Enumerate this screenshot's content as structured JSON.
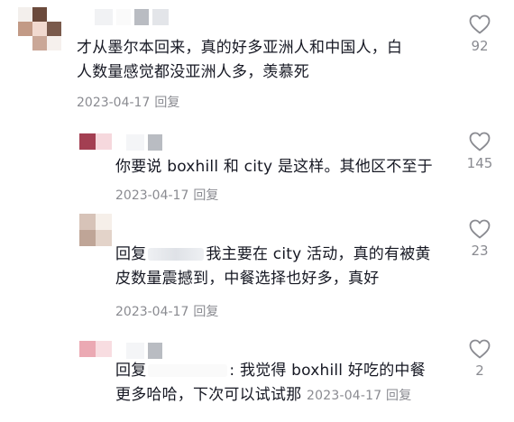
{
  "comments": [
    {
      "text_line1": "才从墨尔本回来，真的好多亚洲人和中国人，白",
      "text_line2": "人数量感觉都没亚洲人多，羡慕死",
      "date": "2023-04-17",
      "reply_label": "回复",
      "likes": "92"
    },
    {
      "text_line1": "你要说 boxhill 和 city 是这样。其他区不至于",
      "date": "2023-04-17",
      "reply_label": "回复",
      "likes": "145"
    },
    {
      "prefix": "回复",
      "text_line1": "我主要在 city 活动，真的有被黄",
      "text_line2": "皮数量震撼到，中餐选择也好多，真好",
      "date": "2023-04-17",
      "reply_label": "回复",
      "likes": "23"
    },
    {
      "prefix": "回复",
      "text_line1": ": 我觉得 boxhill 好吃的中餐",
      "text_line2": "更多哈哈，下次可以试试那",
      "date": "2023-04-17",
      "reply_label": "回复",
      "likes": "2"
    }
  ],
  "icons": {
    "like": "heart-outline-icon"
  },
  "colors": {
    "text": "#161823",
    "meta": "#8a8b91"
  }
}
